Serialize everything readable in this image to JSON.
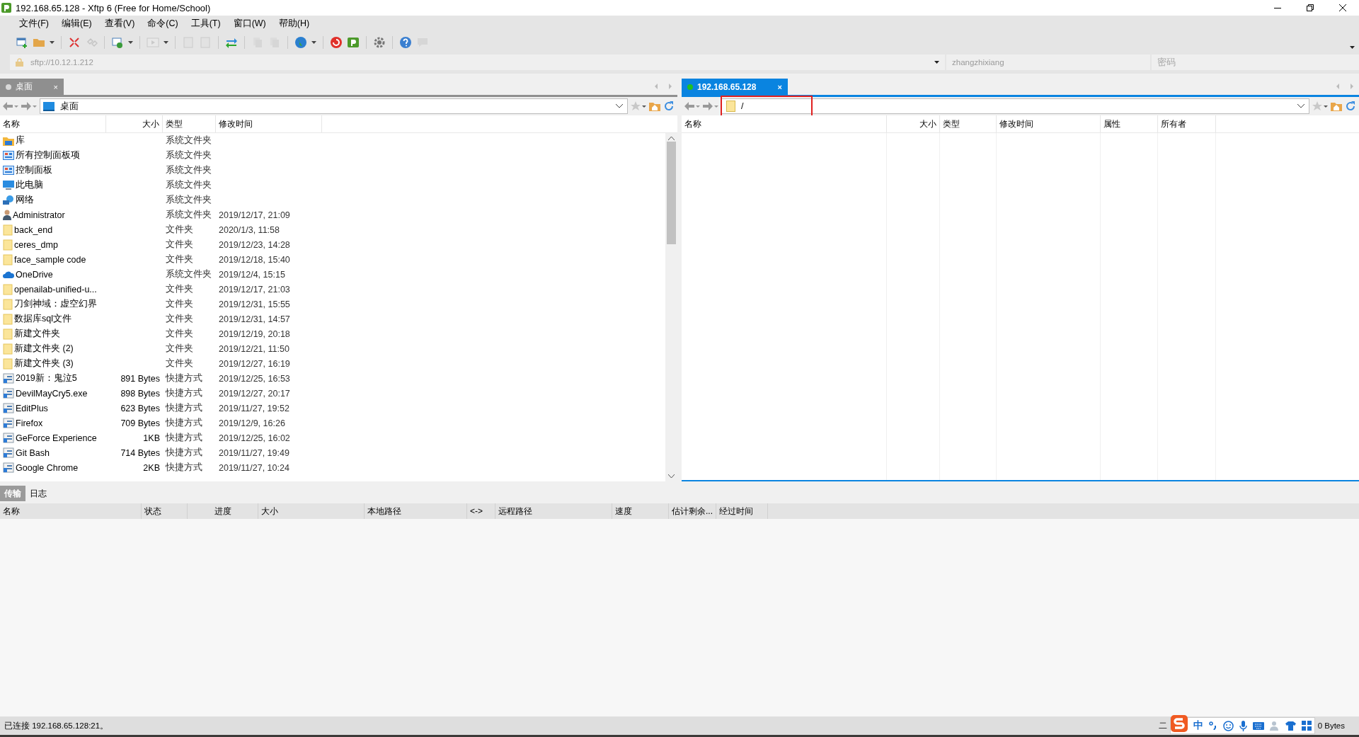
{
  "window": {
    "title": "192.168.65.128 - Xftp 6 (Free for Home/School)"
  },
  "menu": [
    "文件(F)",
    "编辑(E)",
    "查看(V)",
    "命令(C)",
    "工具(T)",
    "窗口(W)",
    "帮助(H)"
  ],
  "address_bar": {
    "url": "sftp://10.12.1.212",
    "username": "zhangzhixiang",
    "password_placeholder": "密码"
  },
  "left_pane": {
    "focused": false,
    "tabs": [
      {
        "label": "桌面",
        "close": "×",
        "selected": true,
        "connected": false
      }
    ],
    "path": "桌面",
    "path_highlighted": false,
    "columns": [
      "名称",
      "大小",
      "类型",
      "修改时间"
    ],
    "rows": [
      {
        "kind": "library",
        "name": "库",
        "type": "系统文件夹"
      },
      {
        "kind": "control-panel",
        "name": "所有控制面板项",
        "type": "系统文件夹"
      },
      {
        "kind": "control-panel",
        "name": "控制面板",
        "type": "系统文件夹"
      },
      {
        "kind": "computer",
        "name": "此电脑",
        "type": "系统文件夹"
      },
      {
        "kind": "network",
        "name": "网络",
        "type": "系统文件夹"
      },
      {
        "kind": "user",
        "name": "Administrator",
        "type": "系统文件夹",
        "modified": "2019/12/17, 21:09"
      },
      {
        "kind": "folder",
        "name": "back_end",
        "type": "文件夹",
        "modified": "2020/1/3, 11:58"
      },
      {
        "kind": "folder",
        "name": "ceres_dmp",
        "type": "文件夹",
        "modified": "2019/12/23, 14:28"
      },
      {
        "kind": "folder",
        "name": "face_sample code",
        "type": "文件夹",
        "modified": "2019/12/18, 15:40"
      },
      {
        "kind": "cloud",
        "name": "OneDrive",
        "type": "系统文件夹",
        "modified": "2019/12/4, 15:15"
      },
      {
        "kind": "folder",
        "name": "openailab-unified-u...",
        "type": "文件夹",
        "modified": "2019/12/17, 21:03"
      },
      {
        "kind": "folder",
        "name": "刀剑神域：虚空幻界",
        "type": "文件夹",
        "modified": "2019/12/31, 15:55"
      },
      {
        "kind": "folder",
        "name": "数据库sql文件",
        "type": "文件夹",
        "modified": "2019/12/31, 14:57"
      },
      {
        "kind": "folder",
        "name": "新建文件夹",
        "type": "文件夹",
        "modified": "2019/12/19, 20:18"
      },
      {
        "kind": "folder",
        "name": "新建文件夹 (2)",
        "type": "文件夹",
        "modified": "2019/12/21, 11:50"
      },
      {
        "kind": "folder",
        "name": "新建文件夹 (3)",
        "type": "文件夹",
        "modified": "2019/12/27, 16:19"
      },
      {
        "kind": "shortcut",
        "name": "2019新：鬼泣5",
        "size": "891 Bytes",
        "type": "快捷方式",
        "modified": "2019/12/25, 16:53"
      },
      {
        "kind": "shortcut",
        "name": "DevilMayCry5.exe",
        "size": "898 Bytes",
        "type": "快捷方式",
        "modified": "2019/12/27, 20:17"
      },
      {
        "kind": "shortcut",
        "name": "EditPlus",
        "size": "623 Bytes",
        "type": "快捷方式",
        "modified": "2019/11/27, 19:52"
      },
      {
        "kind": "shortcut",
        "name": "Firefox",
        "size": "709 Bytes",
        "type": "快捷方式",
        "modified": "2019/12/9, 16:26"
      },
      {
        "kind": "shortcut",
        "name": "GeForce Experience",
        "size": "1KB",
        "type": "快捷方式",
        "modified": "2019/12/25, 16:02"
      },
      {
        "kind": "shortcut",
        "name": "Git Bash",
        "size": "714 Bytes",
        "type": "快捷方式",
        "modified": "2019/11/27, 19:49"
      },
      {
        "kind": "shortcut",
        "name": "Google Chrome",
        "size": "2KB",
        "type": "快捷方式",
        "modified": "2019/11/27, 10:24"
      }
    ]
  },
  "right_pane": {
    "focused": true,
    "tabs": [
      {
        "label": "192.168.65.128",
        "close": "×",
        "selected": true,
        "connected": true
      }
    ],
    "path": "/",
    "path_highlighted": true,
    "columns": [
      "名称",
      "大小",
      "类型",
      "修改时间",
      "属性",
      "所有者"
    ]
  },
  "transfer": {
    "tabs": [
      {
        "label": "传输",
        "selected": true
      },
      {
        "label": "日志",
        "selected": false
      }
    ],
    "columns": [
      "名称",
      "状态",
      "进度",
      "大小",
      "本地路径",
      "<->",
      "远程路径",
      "速度",
      "估计剩余...",
      "经过时间"
    ]
  },
  "status_bar": {
    "message": "已连接 192.168.65.128:21。",
    "encoding": "二",
    "ime_mode": "中",
    "bytes": "0 Bytes"
  }
}
